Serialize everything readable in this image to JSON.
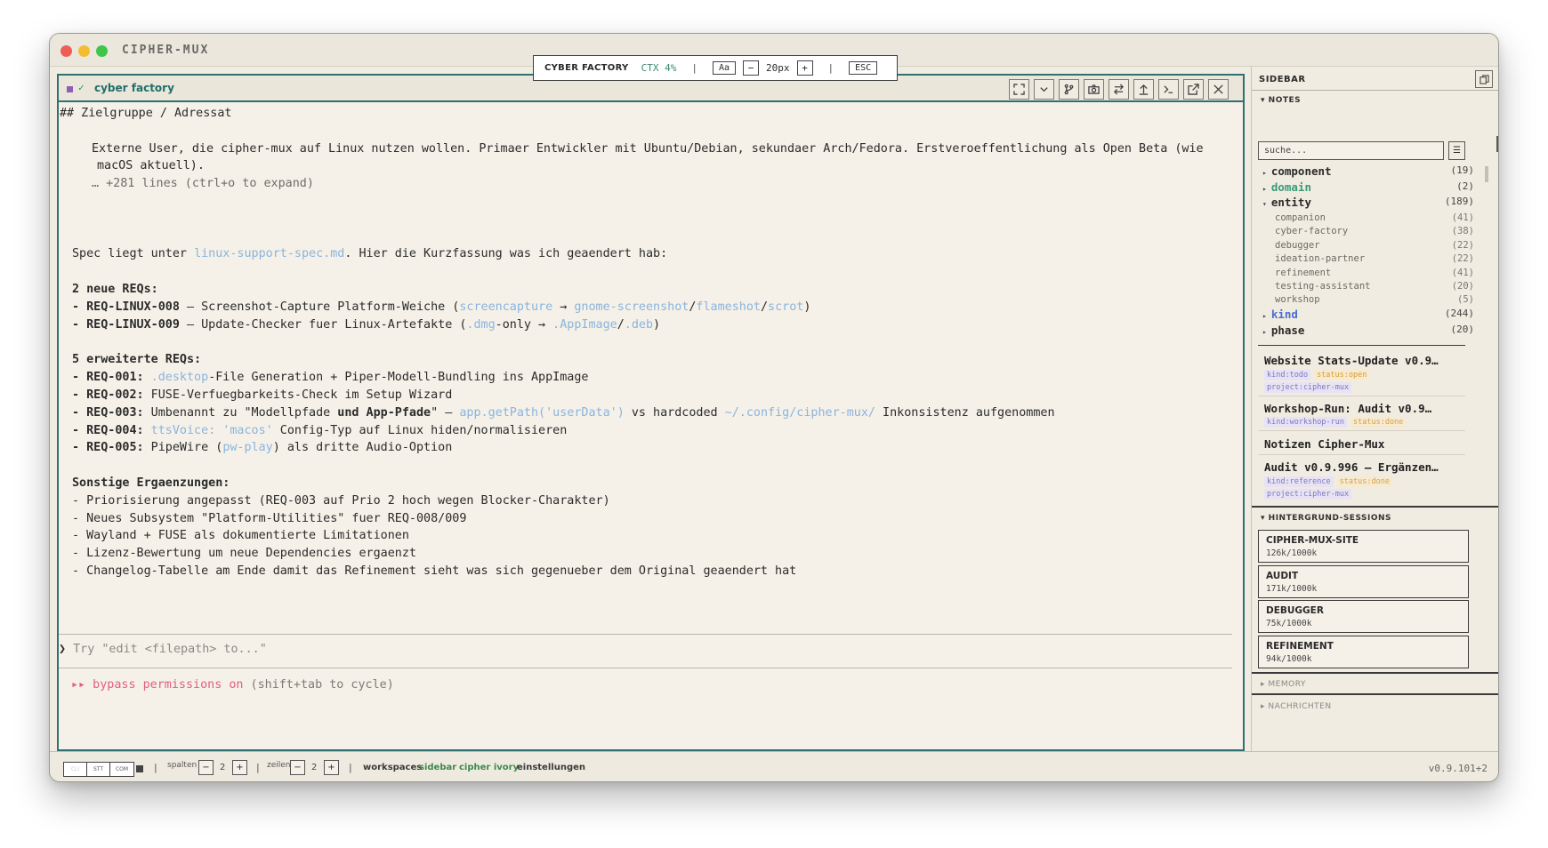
{
  "app": {
    "title": "CIPHER-MUX"
  },
  "pane": {
    "session_name": "cyber factory",
    "overlay": {
      "title": "CYBER FACTORY",
      "ctx": "CTX 4%",
      "font_btn": "Aa",
      "minus": "−",
      "size": "20px",
      "plus": "+",
      "esc": "ESC"
    },
    "lines": {
      "l1": "## Zielgruppe / Adressat",
      "l2": "Externe User, die cipher-mux auf Linux nutzen wollen. Primaer Entwickler mit Ubuntu/Debian, sekundaer Arch/Fedora. Erstveroeffentlichung als Open Beta (wie",
      "l3": "macOS aktuell).",
      "l4": "… +281 lines (ctrl+o to expand)",
      "spec_pre": "Spec liegt unter ",
      "spec_link": "linux-support-spec.md",
      "spec_post": ". Hier die Kurzfassung was ich geaendert hab:",
      "h_new": "2 neue REQs:",
      "r8_id": "- REQ-LINUX-008",
      "r8_a": " — Screenshot-Capture Platform-Weiche (",
      "r8_l1": "screencapture",
      "r8_b": " → ",
      "r8_l2": "gnome-screenshot",
      "r8_c": "/",
      "r8_l3": "flameshot",
      "r8_d": "/",
      "r8_l4": "scrot",
      "r8_e": ")",
      "r9_id": "- REQ-LINUX-009",
      "r9_a": " — Update-Checker fuer Linux-Artefakte (",
      "r9_l1": ".dmg",
      "r9_b": "-only → ",
      "r9_l2": ".AppImage",
      "r9_c": "/",
      "r9_l3": ".deb",
      "r9_d": ")",
      "h_ext": "5 erweiterte REQs:",
      "e1_id": "- REQ-001:",
      "e1_l": " .desktop",
      "e1_t": "-File Generation + Piper-Modell-Bundling ins AppImage",
      "e2_id": "- REQ-002:",
      "e2_t": " FUSE-Verfuegbarkeits-Check im Setup Wizard",
      "e3_id": "- REQ-003:",
      "e3_a": " Umbenannt zu \"Modellpfade ",
      "e3_b": "und App-Pfade",
      "e3_c": "\" — ",
      "e3_l1": "app.getPath('userData')",
      "e3_d": " vs hardcoded ",
      "e3_l2": "~/.config/cipher-mux/",
      "e3_e": " Inkonsistenz aufgenommen",
      "e4_id": "- REQ-004:",
      "e4_l": " ttsVoice: 'macos'",
      "e4_t": " Config-Typ auf Linux hiden/normalisieren",
      "e5_id": "- REQ-005:",
      "e5_a": " PipeWire (",
      "e5_l": "pw-play",
      "e5_b": ") als dritte Audio-Option",
      "h_other": "Sonstige Ergaenzungen:",
      "o1": "- Priorisierung angepasst (REQ-003 auf Prio 2 hoch wegen Blocker-Charakter)",
      "o2": "- Neues Subsystem \"Platform-Utilities\" fuer REQ-008/009",
      "o3": "- Wayland + FUSE als dokumentierte Limitationen",
      "o4": "- Lizenz-Bewertung um neue Dependencies ergaenzt",
      "o5": "- Changelog-Tabelle am Ende damit das Refinement sieht was sich gegenueber dem Original geaendert hat"
    },
    "prompt_caret": "❯",
    "prompt_placeholder": " Try \"edit <filepath> to...\"",
    "bypass_arrows": "▸▸",
    "bypass_text": " bypass permissions on",
    "bypass_hint": " (shift+tab to cycle)"
  },
  "sidebar": {
    "title": "SIDEBAR",
    "notes_label": "NOTES",
    "search_placeholder": "suche...",
    "tree": [
      {
        "label": "component",
        "count": "(19)"
      },
      {
        "label": "domain",
        "count": "(2)"
      },
      {
        "label": "entity",
        "count": "(189)"
      },
      {
        "label": "kind",
        "count": "(244)"
      },
      {
        "label": "phase",
        "count": "(20)"
      }
    ],
    "entity_children": [
      {
        "label": "companion",
        "count": "(41)"
      },
      {
        "label": "cyber-factory",
        "count": "(38)"
      },
      {
        "label": "debugger",
        "count": "(22)"
      },
      {
        "label": "ideation-partner",
        "count": "(22)"
      },
      {
        "label": "refinement",
        "count": "(41)"
      },
      {
        "label": "testing-assistant",
        "count": "(20)"
      },
      {
        "label": "workshop",
        "count": "(5)"
      }
    ],
    "notes": [
      {
        "title": "Website Stats-Update v0.9…",
        "tags": [
          "kind:todo",
          "status:open",
          "project:cipher-mux"
        ]
      },
      {
        "title": "Workshop-Run: Audit v0.9…",
        "tags": [
          "kind:workshop-run",
          "status:done"
        ]
      },
      {
        "title": "Notizen Cipher-Mux",
        "tags": []
      },
      {
        "title": "Audit v0.9.996 — Ergänzen…",
        "tags": [
          "kind:reference",
          "status:done",
          "project:cipher-mux"
        ]
      }
    ],
    "bg_label": "HINTERGRUND-SESSIONS",
    "bg_sessions": [
      {
        "name": "CIPHER-MUX-SITE",
        "tokens": "126k/1000k"
      },
      {
        "name": "AUDIT",
        "tokens": "171k/1000k"
      },
      {
        "name": "DEBUGGER",
        "tokens": "75k/1000k"
      },
      {
        "name": "REFINEMENT",
        "tokens": "94k/1000k"
      }
    ],
    "memory_label": "MEMORY",
    "messages_label": "NACHRICHTEN"
  },
  "footer": {
    "seg": [
      "CLI",
      "STT",
      "COM"
    ],
    "spalten_label": "spalten",
    "spalten_value": "2",
    "zeilen_label": "zeilen",
    "zeilen_value": "2",
    "minus": "−",
    "plus": "+",
    "pipe": "|",
    "workspaces": "workspaces",
    "sidebar": "sidebar",
    "theme": "cipher ivory",
    "settings": "einstellungen",
    "version": "v0.9.101+2"
  },
  "colors": {
    "accent_teal": "#2f7074",
    "link": "#8ab4dd",
    "bypass_pink": "#e0607e"
  }
}
